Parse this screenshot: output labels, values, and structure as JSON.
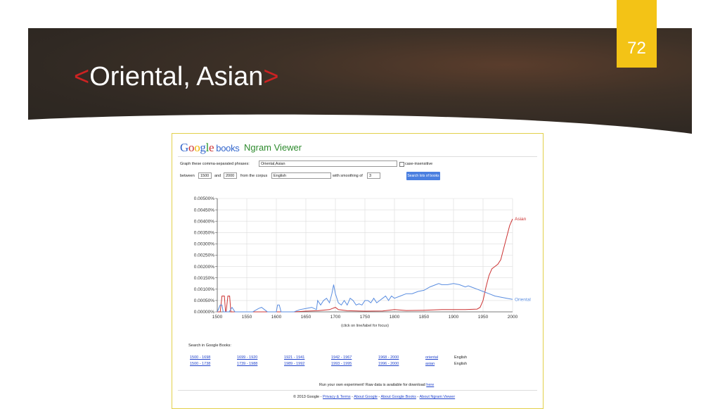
{
  "slide": {
    "page_number": "72",
    "title_open": "<",
    "title_text": "Oriental, Asian",
    "title_close": ">"
  },
  "app": {
    "logo": [
      "G",
      "o",
      "o",
      "g",
      "l",
      "e"
    ],
    "logo_colors": [
      "#3366cc",
      "#cc3333",
      "#f0b400",
      "#3366cc",
      "#2e9a2e",
      "#cc3333"
    ],
    "logo_books": "books",
    "product": "Ngram Viewer"
  },
  "form": {
    "phrases_label": "Graph these comma-separated phrases:",
    "phrases_value": "Oriental,Asian",
    "case_label": "case-insensitive",
    "between_label": "between",
    "start_year": "1500",
    "and_label": "and",
    "end_year": "2000",
    "corpus_label": "from the corpus",
    "corpus_value": "English",
    "smoothing_label": "with smoothing of",
    "smoothing_value": "3",
    "search_button": "Search lots of books"
  },
  "chart_data": {
    "type": "line",
    "x_range": [
      1500,
      2000
    ],
    "y_range": [
      0,
      0.005
    ],
    "x_ticks": [
      "1500",
      "1550",
      "1600",
      "1650",
      "1700",
      "1750",
      "1800",
      "1850",
      "1900",
      "1950",
      "2000"
    ],
    "y_ticks": [
      "0.00000%",
      "0.00050%",
      "0.00100%",
      "0.00150%",
      "0.00200%",
      "0.00250%",
      "0.00300%",
      "0.00350%",
      "0.00400%",
      "0.00450%",
      "0.00500%"
    ],
    "grid": true,
    "hint": "(click on line/label for focus)",
    "series": [
      {
        "name": "Asian",
        "color": "#cc3333",
        "points": [
          [
            1500,
            0
          ],
          [
            1505,
            0
          ],
          [
            1508,
            0.0007
          ],
          [
            1512,
            0.0007
          ],
          [
            1514,
            0
          ],
          [
            1515,
            0
          ],
          [
            1518,
            0.0007
          ],
          [
            1521,
            0.0007
          ],
          [
            1523,
            0
          ],
          [
            1550,
            0
          ],
          [
            1580,
            0
          ],
          [
            1600,
            0
          ],
          [
            1630,
            0
          ],
          [
            1650,
            3e-05
          ],
          [
            1670,
            5e-05
          ],
          [
            1690,
            0.0001
          ],
          [
            1695,
            0.00015
          ],
          [
            1700,
            0.0002
          ],
          [
            1705,
            0.0001
          ],
          [
            1720,
            5e-05
          ],
          [
            1750,
            3e-05
          ],
          [
            1780,
            4e-05
          ],
          [
            1800,
            0.0001
          ],
          [
            1820,
            6e-05
          ],
          [
            1850,
            7e-05
          ],
          [
            1880,
            0.0001
          ],
          [
            1900,
            0.0001
          ],
          [
            1920,
            0.0001
          ],
          [
            1940,
            0.00012
          ],
          [
            1945,
            0.0002
          ],
          [
            1950,
            0.0005
          ],
          [
            1955,
            0.0011
          ],
          [
            1960,
            0.0016
          ],
          [
            1965,
            0.0019
          ],
          [
            1970,
            0.002
          ],
          [
            1975,
            0.0021
          ],
          [
            1980,
            0.0023
          ],
          [
            1985,
            0.0028
          ],
          [
            1990,
            0.0033
          ],
          [
            1995,
            0.0038
          ],
          [
            2000,
            0.0041
          ]
        ]
      },
      {
        "name": "Oriental",
        "color": "#5a8de0",
        "points": [
          [
            1500,
            0
          ],
          [
            1505,
            0.0003
          ],
          [
            1508,
            0.0003
          ],
          [
            1510,
            0
          ],
          [
            1520,
            0
          ],
          [
            1525,
            0.0002
          ],
          [
            1530,
            0
          ],
          [
            1560,
            0
          ],
          [
            1570,
            0.00015
          ],
          [
            1575,
            0.0002
          ],
          [
            1580,
            0.0001
          ],
          [
            1585,
            0
          ],
          [
            1600,
            0
          ],
          [
            1602,
            0.0003
          ],
          [
            1605,
            0.0003
          ],
          [
            1608,
            0
          ],
          [
            1630,
            0
          ],
          [
            1640,
            0.0001
          ],
          [
            1650,
            0.00015
          ],
          [
            1660,
            0.0002
          ],
          [
            1668,
            0.0001
          ],
          [
            1670,
            0.0005
          ],
          [
            1675,
            0.0003
          ],
          [
            1680,
            0.0005
          ],
          [
            1685,
            0.0006
          ],
          [
            1690,
            0.0004
          ],
          [
            1694,
            0.0008
          ],
          [
            1697,
            0.0012
          ],
          [
            1700,
            0.0008
          ],
          [
            1705,
            0.0004
          ],
          [
            1710,
            0.0003
          ],
          [
            1715,
            0.0005
          ],
          [
            1720,
            0.0003
          ],
          [
            1725,
            0.0006
          ],
          [
            1730,
            0.0005
          ],
          [
            1735,
            0.0003
          ],
          [
            1740,
            0.00035
          ],
          [
            1745,
            0.0003
          ],
          [
            1750,
            0.0005
          ],
          [
            1755,
            0.0005
          ],
          [
            1760,
            0.0004
          ],
          [
            1765,
            0.0006
          ],
          [
            1770,
            0.0004
          ],
          [
            1775,
            0.0005
          ],
          [
            1780,
            0.0006
          ],
          [
            1785,
            0.0007
          ],
          [
            1790,
            0.0005
          ],
          [
            1795,
            0.0007
          ],
          [
            1800,
            0.0006
          ],
          [
            1810,
            0.0007
          ],
          [
            1820,
            0.0008
          ],
          [
            1830,
            0.0008
          ],
          [
            1840,
            0.0009
          ],
          [
            1850,
            0.00095
          ],
          [
            1860,
            0.0011
          ],
          [
            1865,
            0.00115
          ],
          [
            1870,
            0.0012
          ],
          [
            1875,
            0.00125
          ],
          [
            1880,
            0.0012
          ],
          [
            1890,
            0.0012
          ],
          [
            1900,
            0.00125
          ],
          [
            1910,
            0.0012
          ],
          [
            1920,
            0.0011
          ],
          [
            1925,
            0.00115
          ],
          [
            1930,
            0.0011
          ],
          [
            1940,
            0.001
          ],
          [
            1950,
            0.0009
          ],
          [
            1960,
            0.0008
          ],
          [
            1970,
            0.0007
          ],
          [
            1980,
            0.00065
          ],
          [
            1990,
            0.0006
          ],
          [
            2000,
            0.00055
          ]
        ]
      }
    ]
  },
  "search": {
    "title": "Search in Google Books:",
    "rows": [
      [
        "1500 - 1698",
        "1699 - 1920",
        "1921 - 1941",
        "1942 - 1967",
        "1968 - 2000",
        "oriental",
        "English"
      ],
      [
        "1500 - 1738",
        "1739 - 1988",
        "1989 - 1992",
        "1993 - 1995",
        "1996 - 2000",
        "asian",
        "English"
      ]
    ]
  },
  "footer": {
    "experiment_text": "Run your own experiment! Raw data is available for download",
    "experiment_link": "here",
    "copyright": "© 2013 Google -",
    "links": [
      "Privacy & Terms",
      "About Google",
      "About Google Books",
      "About Ngram Viewer"
    ]
  }
}
